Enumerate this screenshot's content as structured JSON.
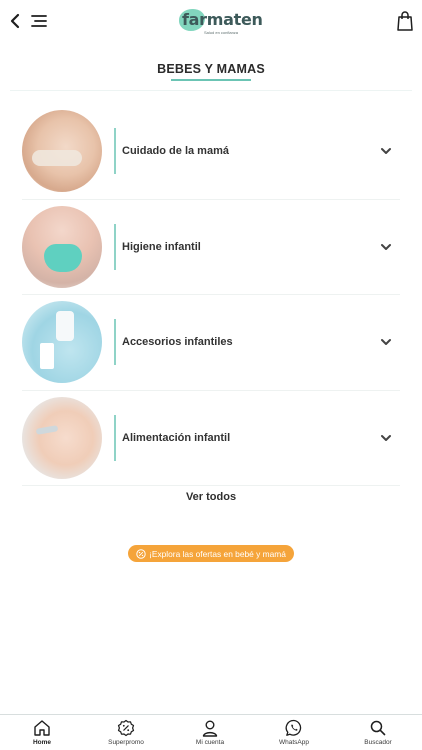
{
  "header": {
    "logo_text": "farmaten",
    "logo_tagline": "Salud en confianza"
  },
  "page": {
    "title": "BEBES Y MAMAS"
  },
  "categories": [
    {
      "label": "Cuidado de la mamá",
      "icon": "chevron-down-icon"
    },
    {
      "label": "Higiene infantil",
      "icon": "chevron-down-icon"
    },
    {
      "label": "Accesorios infantiles",
      "icon": "chevron-down-icon"
    },
    {
      "label": "Alimentación infantil",
      "icon": "chevron-down-icon"
    }
  ],
  "ver_todos": "Ver todos",
  "promo": {
    "label": "¡Explora las ofertas en bebé y mamá",
    "color": "#f5a43a"
  },
  "bottom_nav": [
    {
      "label": "Home",
      "icon": "home-icon",
      "active": true
    },
    {
      "label": "Superpromo",
      "icon": "percent-badge-icon",
      "active": false
    },
    {
      "label": "Mi cuenta",
      "icon": "user-icon",
      "active": false
    },
    {
      "label": "WhatsApp",
      "icon": "whatsapp-icon",
      "active": false
    },
    {
      "label": "Buscador",
      "icon": "search-icon",
      "active": false
    }
  ],
  "colors": {
    "accent": "#6bc4b4",
    "promo": "#f5a43a"
  }
}
